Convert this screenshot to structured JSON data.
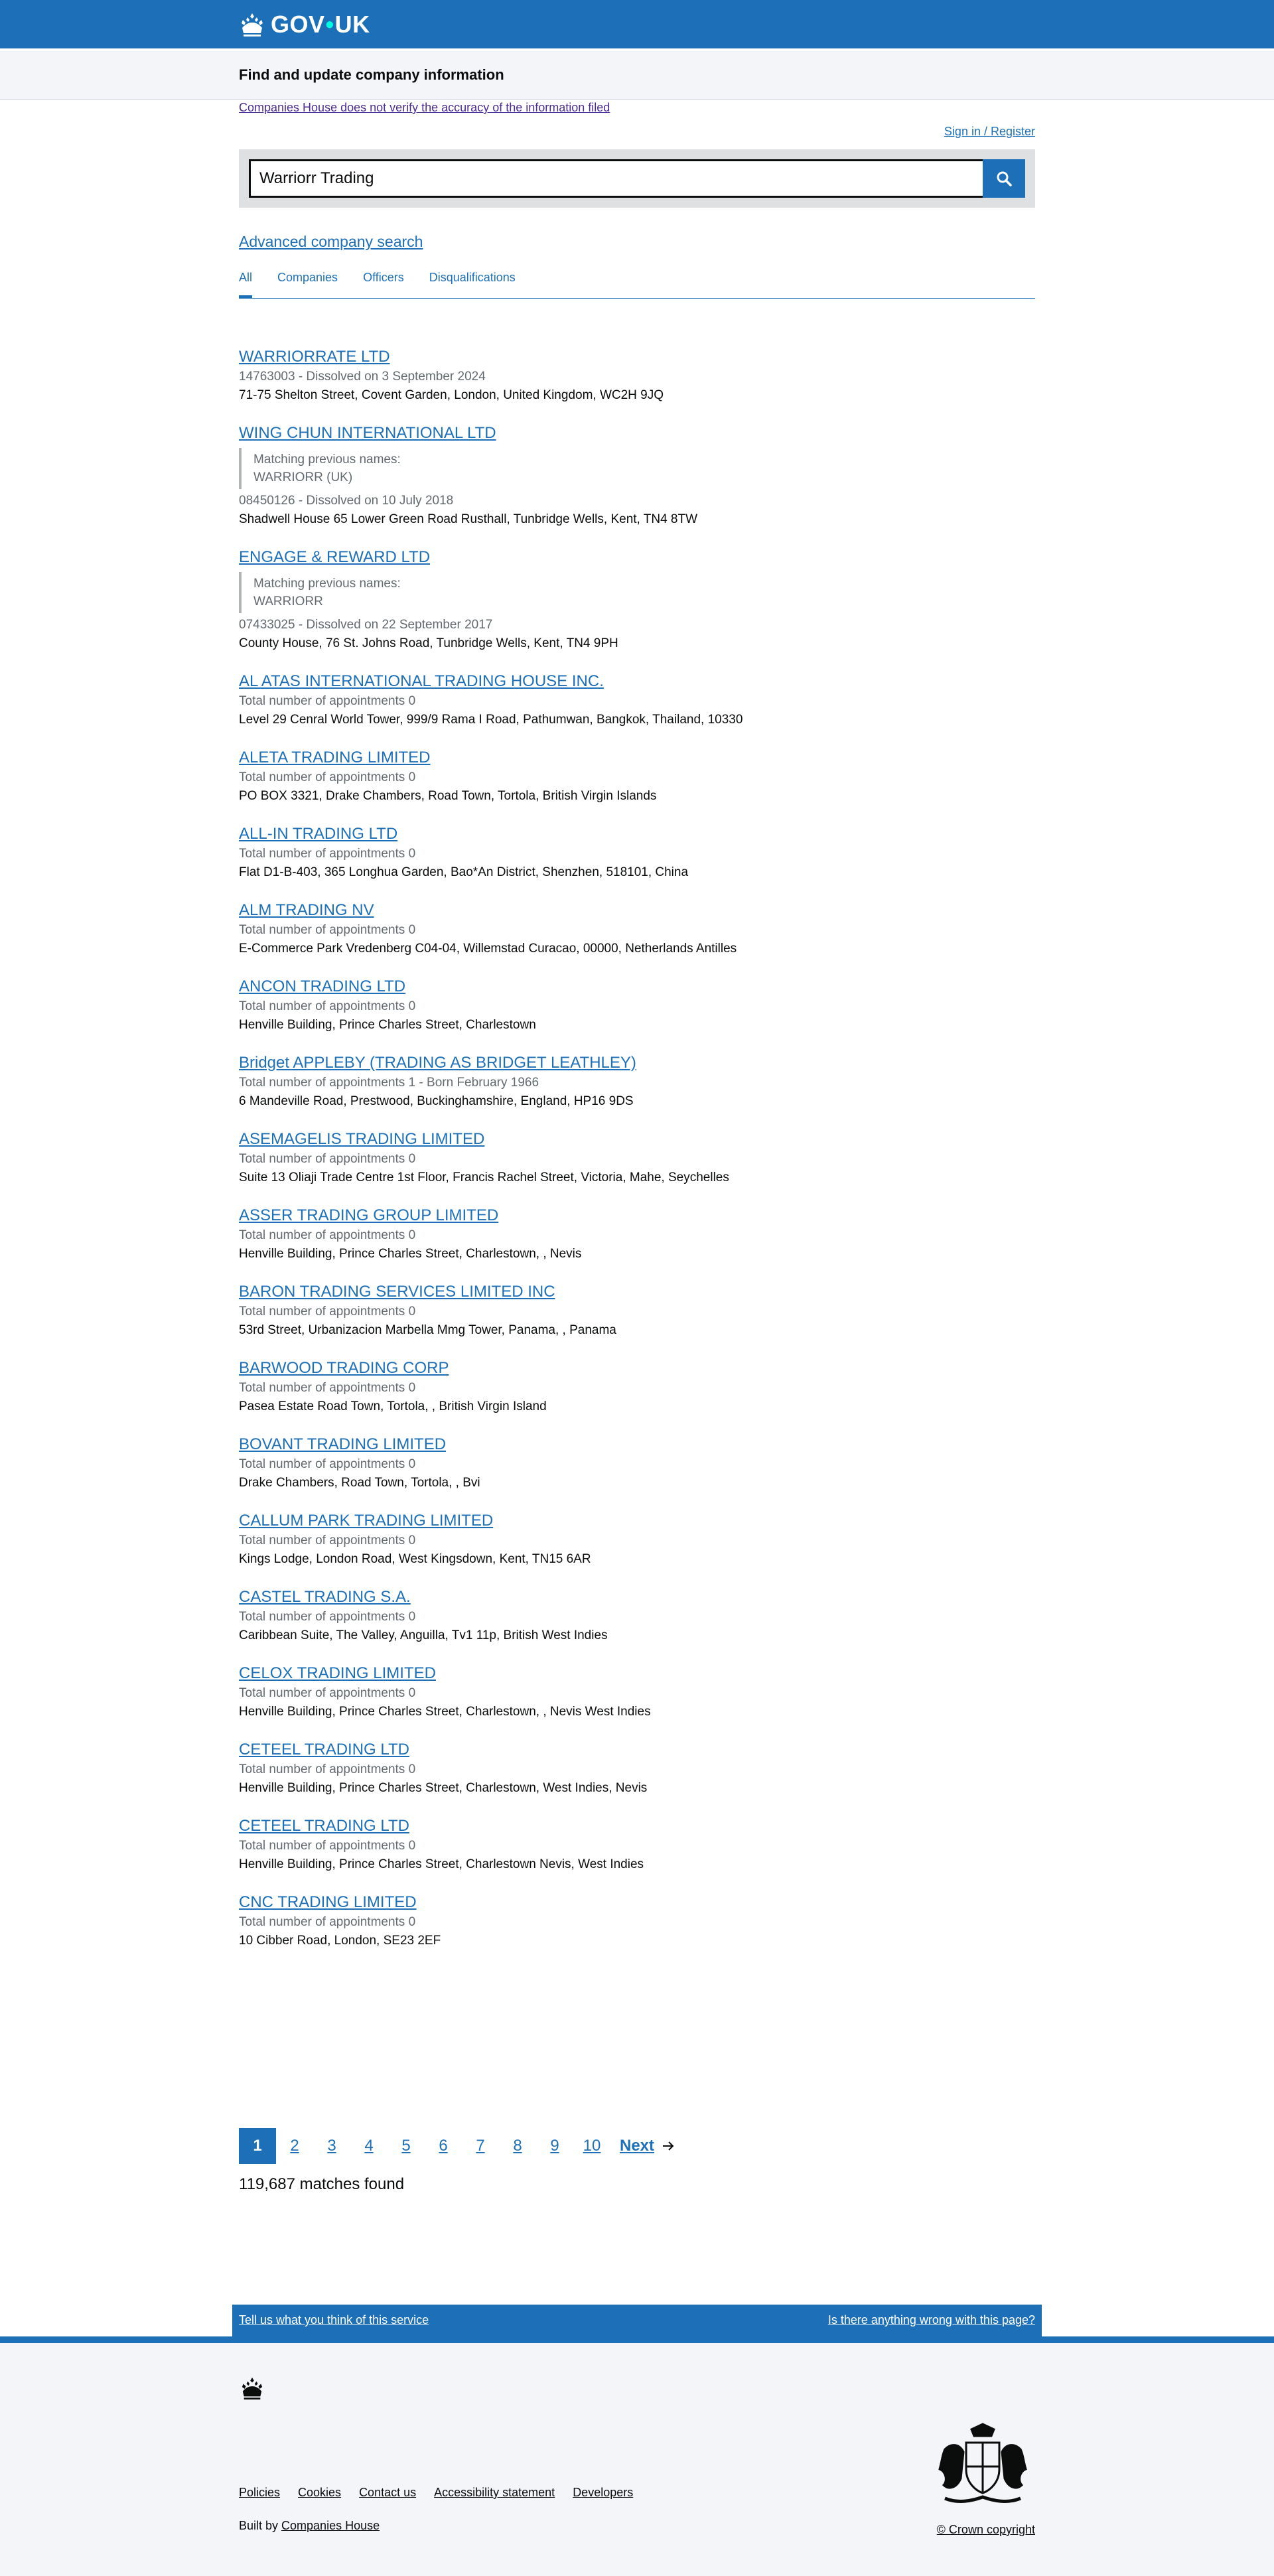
{
  "header": {
    "logo_text_a": "GOV",
    "logo_dot": "•",
    "logo_text_b": "UK"
  },
  "service": {
    "name": "Find and update company information"
  },
  "notice": {
    "text": "Companies House does not verify the accuracy of the information filed"
  },
  "signin": {
    "label": "Sign in / Register"
  },
  "search": {
    "value": "Warriorr Trading",
    "button_icon": "search-icon"
  },
  "advanced": {
    "label": "Advanced company search"
  },
  "tabs": [
    {
      "label": "All",
      "active": true
    },
    {
      "label": "Companies",
      "active": false
    },
    {
      "label": "Officers",
      "active": false
    },
    {
      "label": "Disqualifications",
      "active": false
    }
  ],
  "results": [
    {
      "title": "WARRIORRATE LTD",
      "meta": "14763003 - Dissolved on 3 September 2024",
      "address": "71-75 Shelton Street, Covent Garden, London, United Kingdom, WC2H 9JQ"
    },
    {
      "title": "WING CHUN INTERNATIONAL LTD",
      "prev_label": "Matching previous names:",
      "prev_name": "WARRIORR (UK)",
      "meta": "08450126 - Dissolved on 10 July 2018",
      "address": "Shadwell House 65 Lower Green Road Rusthall, Tunbridge Wells, Kent, TN4 8TW"
    },
    {
      "title": "ENGAGE & REWARD LTD",
      "prev_label": "Matching previous names:",
      "prev_name": "WARRIORR",
      "meta": "07433025 - Dissolved on 22 September 2017",
      "address": "County House, 76 St. Johns Road, Tunbridge Wells, Kent, TN4 9PH"
    },
    {
      "title": "AL ATAS INTERNATIONAL TRADING HOUSE INC.",
      "meta": "Total number of appointments 0",
      "address": "Level 29 Cenral World Tower, 999/9 Rama I Road, Pathumwan, Bangkok, Thailand, 10330"
    },
    {
      "title": "ALETA TRADING LIMITED",
      "meta": "Total number of appointments 0",
      "address": "PO BOX 3321, Drake Chambers, Road Town, Tortola, British Virgin Islands"
    },
    {
      "title": "ALL-IN TRADING LTD",
      "meta": "Total number of appointments 0",
      "address": "Flat D1-B-403, 365 Longhua Garden, Bao*An District, Shenzhen, 518101, China"
    },
    {
      "title": "ALM TRADING NV",
      "meta": "Total number of appointments 0",
      "address": "E-Commerce Park Vredenberg C04-04, Willemstad Curacao, 00000, Netherlands Antilles"
    },
    {
      "title": "ANCON TRADING LTD",
      "meta": "Total number of appointments 0",
      "address": "Henville Building, Prince Charles Street, Charlestown"
    },
    {
      "title": "Bridget APPLEBY (TRADING AS BRIDGET LEATHLEY)",
      "meta": "Total number of appointments 1 - Born February 1966",
      "address": "6 Mandeville Road, Prestwood, Buckinghamshire, England, HP16 9DS"
    },
    {
      "title": "ASEMAGELIS TRADING LIMITED",
      "meta": "Total number of appointments 0",
      "address": "Suite 13 Oliaji Trade Centre 1st Floor, Francis Rachel Street, Victoria, Mahe, Seychelles"
    },
    {
      "title": "ASSER TRADING GROUP LIMITED",
      "meta": "Total number of appointments 0",
      "address": "Henville Building, Prince Charles Street, Charlestown, , Nevis"
    },
    {
      "title": "BARON TRADING SERVICES LIMITED INC",
      "meta": "Total number of appointments 0",
      "address": "53rd Street, Urbanizacion Marbella Mmg Tower, Panama, , Panama"
    },
    {
      "title": "BARWOOD TRADING CORP",
      "meta": "Total number of appointments 0",
      "address": "Pasea Estate Road Town, Tortola, , British Virgin Island"
    },
    {
      "title": "BOVANT TRADING LIMITED",
      "meta": "Total number of appointments 0",
      "address": "Drake Chambers, Road Town, Tortola, , Bvi"
    },
    {
      "title": "CALLUM PARK TRADING LIMITED",
      "meta": "Total number of appointments 0",
      "address": "Kings Lodge, London Road, West Kingsdown, Kent, TN15 6AR"
    },
    {
      "title": "CASTEL TRADING S.A.",
      "meta": "Total number of appointments 0",
      "address": "Caribbean Suite, The Valley, Anguilla, Tv1 11p, British West Indies"
    },
    {
      "title": "CELOX TRADING LIMITED",
      "meta": "Total number of appointments 0",
      "address": "Henville Building, Prince Charles Street, Charlestown, , Nevis West Indies"
    },
    {
      "title": "CETEEL TRADING LTD",
      "meta": "Total number of appointments 0",
      "address": "Henville Building, Prince Charles Street, Charlestown, West Indies, Nevis"
    },
    {
      "title": "CETEEL TRADING LTD",
      "meta": "Total number of appointments 0",
      "address": "Henville Building, Prince Charles Street, Charlestown Nevis, West Indies"
    },
    {
      "title": "CNC TRADING LIMITED",
      "meta": "Total number of appointments 0",
      "address": "10 Cibber Road, London, SE23 2EF"
    }
  ],
  "pagination": {
    "pages": [
      "1",
      "2",
      "3",
      "4",
      "5",
      "6",
      "7",
      "8",
      "9",
      "10"
    ],
    "current": "1",
    "next_label": "Next",
    "next_icon": "arrow-right-icon"
  },
  "match_count": "119,687 matches found",
  "feedback": {
    "left": "Tell us what you think of this service",
    "right": "Is there anything wrong with this page?"
  },
  "footer": {
    "links": [
      "Policies",
      "Cookies",
      "Contact us",
      "Accessibility statement",
      "Developers"
    ],
    "built_prefix": "Built by ",
    "built_link": "Companies House",
    "copyright": "© Crown copyright",
    "accent": "#1d70b8"
  }
}
